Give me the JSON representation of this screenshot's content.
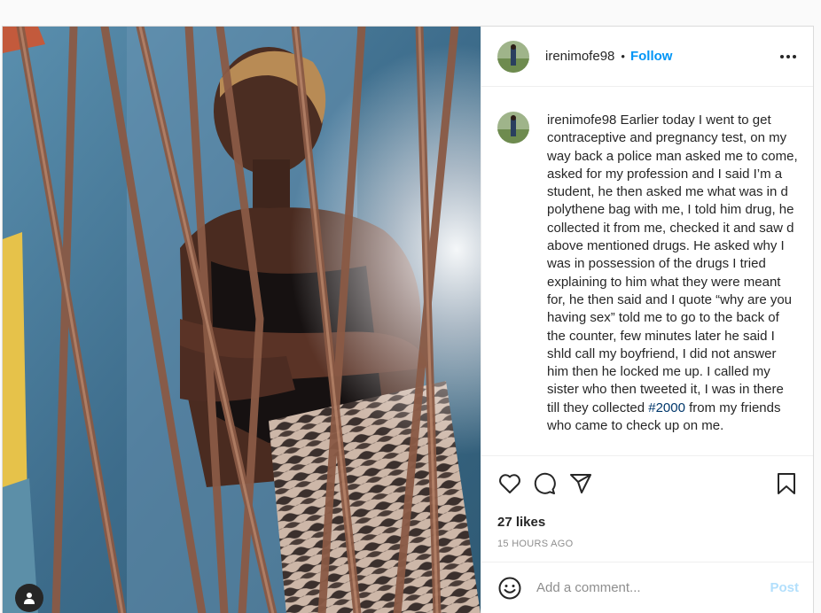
{
  "post": {
    "username": "irenimofe98",
    "separator": "•",
    "follow_label": "Follow",
    "caption_username": "irenimofe98",
    "caption_before_tag": " Earlier today I went to get contraceptive and pregnancy test, on my way back a police man asked me to come, asked for my profession and I said I’m a student, he then asked me what was in d polythene bag with me, I told him drug, he collected it from me, checked it and saw d above mentioned drugs. He asked why I was in possession of the drugs I tried explaining to him what they were meant for, he then said and I quote “why are you having sex” told me to go to the back of the counter, few minutes later he said I shld call my boyfriend, I did not answer him then he locked me up. I called my sister who then tweeted it, I was in there till they collected ",
    "caption_tag": "#2000",
    "caption_after_tag": " from my friends who came to check up on me.",
    "likes": "27 likes",
    "timestamp": "15 HOURS AGO"
  },
  "comment_box": {
    "placeholder": "Add a comment...",
    "post_label": "Post"
  },
  "icons": {
    "more": "more-options-icon",
    "like": "heart-icon",
    "comment": "comment-icon",
    "share": "paper-plane-icon",
    "save": "bookmark-icon",
    "emoji": "smiley-icon",
    "user_tag": "user-tag-icon"
  },
  "colors": {
    "accent": "#0095f6",
    "post_disabled": "#b2dffc",
    "hashtag": "#00376b",
    "muted": "#8e8e8e"
  }
}
